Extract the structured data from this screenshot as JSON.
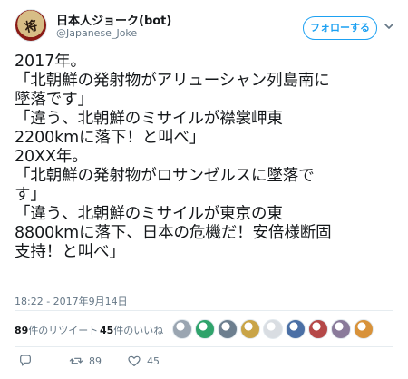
{
  "author": {
    "display_name": "日本人ジョーク(bot)",
    "handle": "@Japanese_Joke",
    "avatar_text": "将"
  },
  "follow_button": {
    "label": "フォローする"
  },
  "tweet": {
    "lines": [
      "2017年。",
      "「北朝鮮の発射物がアリューシャン列島南に",
      "墜落です」",
      "「違う、北朝鮮のミサイルが襟裳岬東",
      "2200kmに落下！と叫べ」",
      "20XX年。",
      "「北朝鮮の発射物がロサンゼルスに墜落で",
      "す」",
      "「違う、北朝鮮のミサイルが東京の東",
      "8800kmに落下、日本の危機だ！安倍様断固",
      "支持！と叫べ」"
    ],
    "timestamp": "18:22 - 2017年9月14日"
  },
  "stats": {
    "retweets_count": "89",
    "retweets_label": "件のリツイート",
    "likes_count": "45",
    "likes_label": "件のいいね",
    "liker_avatar_colors": [
      "#9aa5b1",
      "#2fa36b",
      "#6d7f8f",
      "#c9a447",
      "#d9dde2",
      "#4a6fa5",
      "#b54848",
      "#8a7a9a",
      "#d8923a"
    ]
  },
  "actions": {
    "reply_icon": "reply-icon",
    "retweet_icon": "retweet-icon",
    "retweet_count": "89",
    "like_icon": "heart-icon",
    "like_count": "45",
    "accent": "#1da1f2",
    "muted": "#657786"
  }
}
